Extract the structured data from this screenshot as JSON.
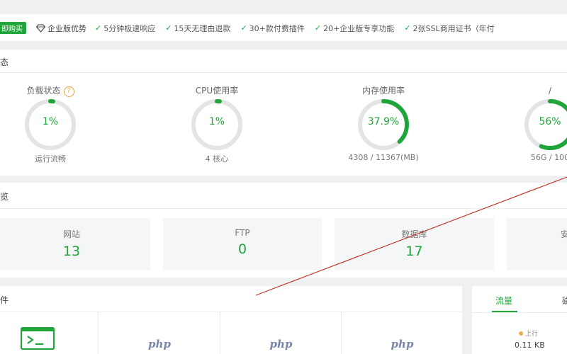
{
  "promo": {
    "buy_label": "即购买",
    "pro_label": "企业版优势",
    "features": [
      "5分钟极速响应",
      "15天无理由退款",
      "30+款付费插件",
      "20+企业版专享功能",
      "2张SSL商用证书（年付"
    ]
  },
  "status": {
    "title": "态",
    "gauges": [
      {
        "label": "负载状态",
        "help": "?",
        "value": "1%",
        "sub": "运行流畅",
        "percent": 1
      },
      {
        "label": "CPU使用率",
        "value": "1%",
        "sub": "4 核心",
        "percent": 1
      },
      {
        "label": "内存使用率",
        "value": "37.9%",
        "sub": "4308 / 11367(MB)",
        "percent": 37.9
      },
      {
        "label": "/",
        "value": "56%",
        "sub": "56G / 100",
        "percent": 56
      }
    ]
  },
  "overview": {
    "title": "览",
    "items": [
      {
        "label": "网站",
        "value": "13"
      },
      {
        "label": "FTP",
        "value": "0"
      },
      {
        "label": "数据库",
        "value": "17"
      },
      {
        "label": "安"
      }
    ]
  },
  "software": {
    "title": "件",
    "tiles": [
      {
        "icon": "terminal-icon"
      },
      {
        "logo": "php"
      },
      {
        "logo": "php"
      },
      {
        "logo": "php"
      }
    ]
  },
  "traffic": {
    "tab_active": "流量",
    "tab_second": "磁",
    "up_label": "上行",
    "up_value": "0.11 KB"
  },
  "colors": {
    "accent": "#20a53a",
    "track": "#e4e4e4",
    "annotation": "#c0392b"
  }
}
